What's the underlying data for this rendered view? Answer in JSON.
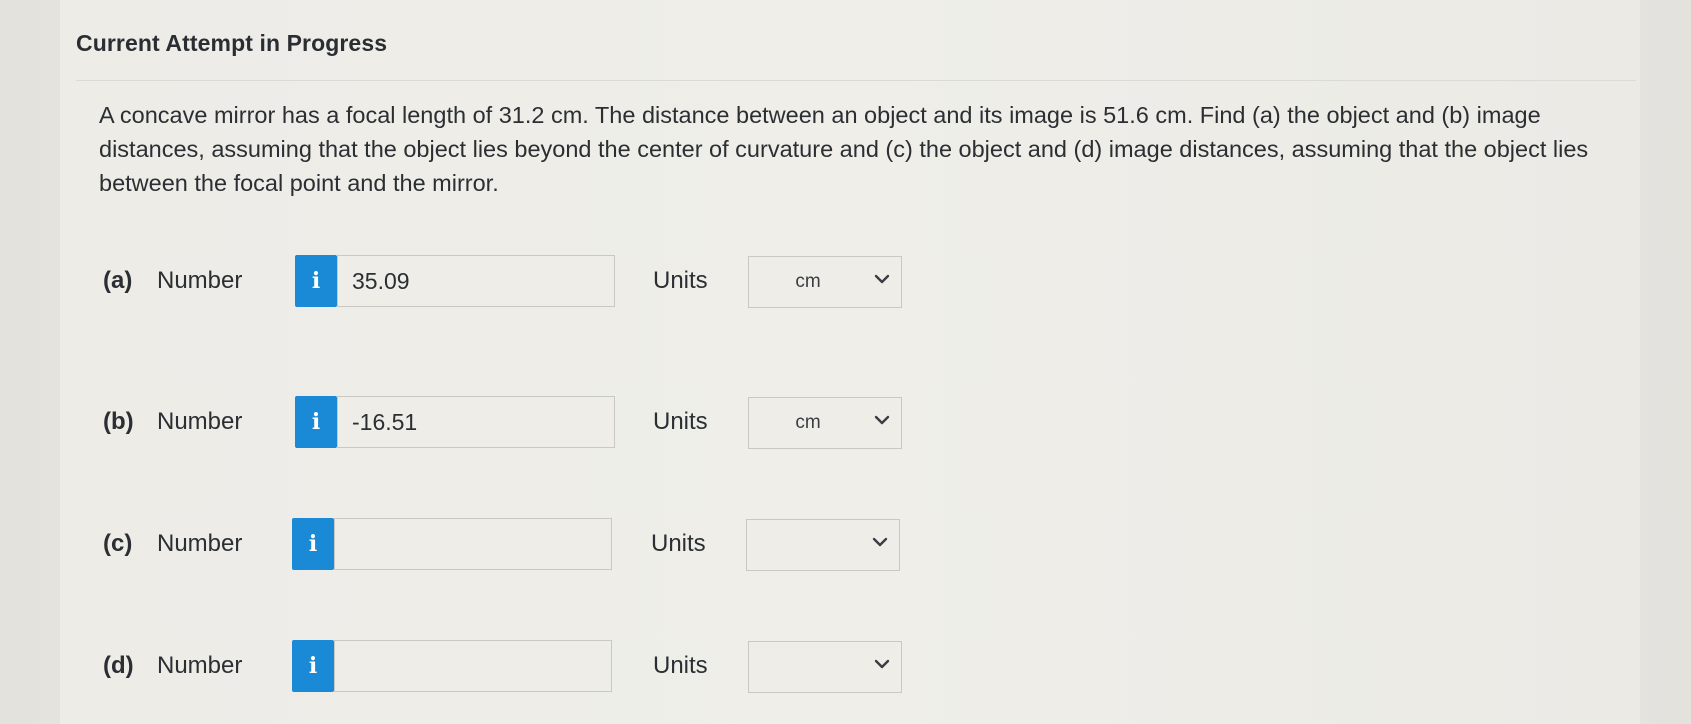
{
  "header": {
    "title": "Current Attempt in Progress"
  },
  "question": {
    "text": "A concave mirror has a focal length of 31.2 cm. The distance between an object and its image is 51.6 cm. Find (a) the object and (b) image distances, assuming that the object lies beyond the center of curvature and (c) the object and (d) image distances, assuming that the object lies between the focal point and the mirror."
  },
  "parts": [
    {
      "label": "(a)",
      "number_label": "Number",
      "info_glyph": "i",
      "value": "35.09",
      "units_label": "Units",
      "unit": "cm"
    },
    {
      "label": "(b)",
      "number_label": "Number",
      "info_glyph": "i",
      "value": "-16.51",
      "units_label": "Units",
      "unit": "cm"
    },
    {
      "label": "(c)",
      "number_label": "Number",
      "info_glyph": "i",
      "value": "",
      "units_label": "Units",
      "unit": ""
    },
    {
      "label": "(d)",
      "number_label": "Number",
      "info_glyph": "i",
      "value": "",
      "units_label": "Units",
      "unit": ""
    }
  ],
  "icons": {
    "info": "info-icon",
    "dropdown": "chevron-down-icon"
  },
  "colors": {
    "info_button": "#1a8ad6",
    "text": "#2b2f33",
    "background": "#edece7"
  }
}
